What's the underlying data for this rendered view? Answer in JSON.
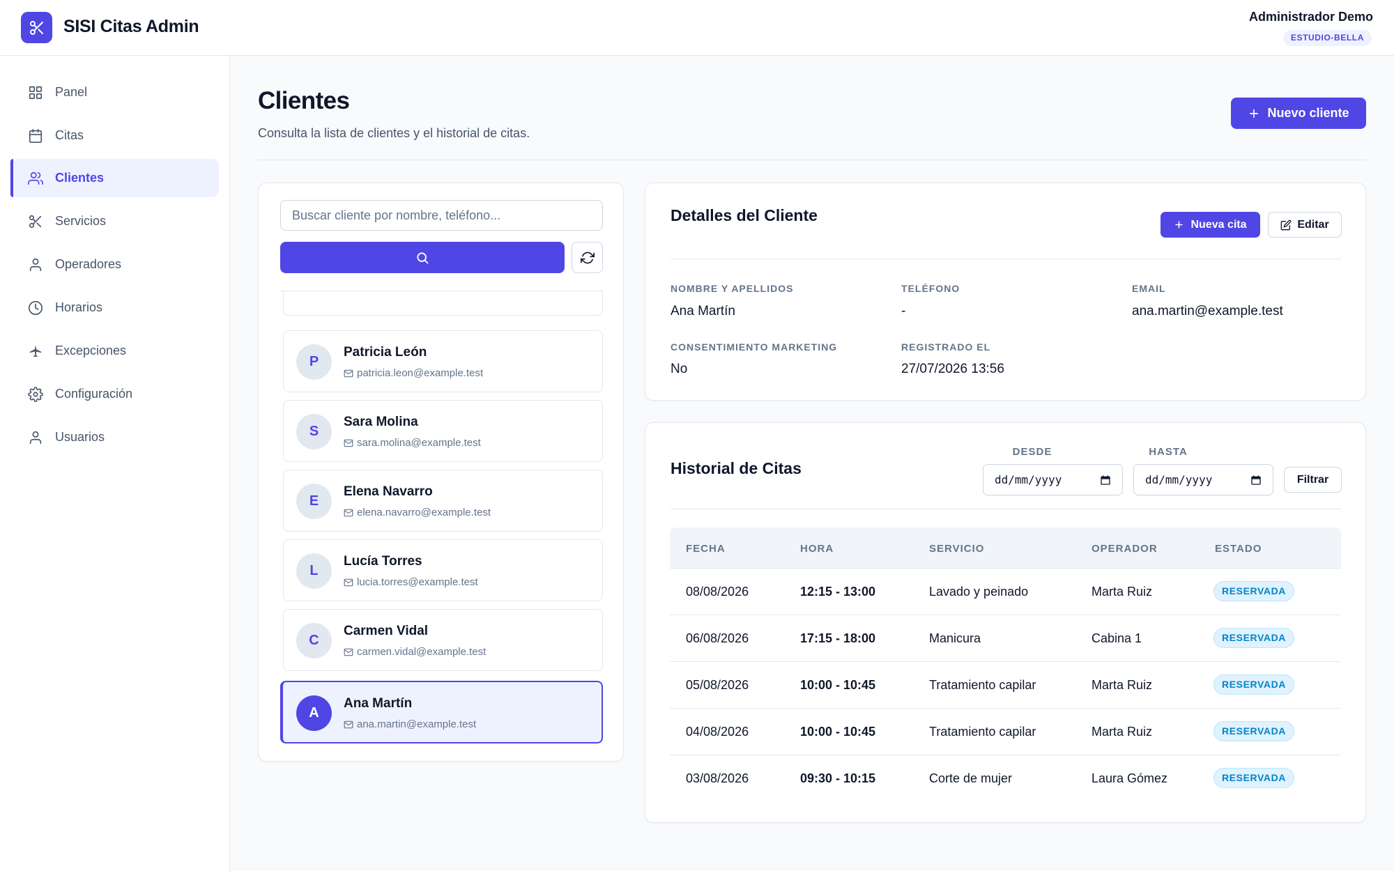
{
  "app": {
    "title": "SISI Citas Admin",
    "logo_icon": "scissors-icon",
    "accent_color": "#4f46e5"
  },
  "user": {
    "name": "Administrador Demo",
    "tenant": "ESTUDIO-BELLA"
  },
  "sidebar": {
    "items": [
      {
        "label": "Panel",
        "icon": "grid-icon"
      },
      {
        "label": "Citas",
        "icon": "calendar-icon"
      },
      {
        "label": "Clientes",
        "icon": "users-icon",
        "active": true
      },
      {
        "label": "Servicios",
        "icon": "scissors-icon"
      },
      {
        "label": "Operadores",
        "icon": "user-icon"
      },
      {
        "label": "Horarios",
        "icon": "clock-icon"
      },
      {
        "label": "Excepciones",
        "icon": "plane-icon"
      },
      {
        "label": "Configuración",
        "icon": "gear-icon"
      },
      {
        "label": "Usuarios",
        "icon": "user-icon"
      }
    ]
  },
  "page": {
    "title": "Clientes",
    "subtitle": "Consulta la lista de clientes y el historial de citas.",
    "new_client_label": "Nuevo cliente"
  },
  "search": {
    "placeholder": "Buscar cliente por nombre, teléfono...",
    "value": ""
  },
  "clients": [
    {
      "initial": "P",
      "name": "Patricia León",
      "email": "patricia.leon@example.test"
    },
    {
      "initial": "S",
      "name": "Sara Molina",
      "email": "sara.molina@example.test"
    },
    {
      "initial": "E",
      "name": "Elena Navarro",
      "email": "elena.navarro@example.test"
    },
    {
      "initial": "L",
      "name": "Lucía Torres",
      "email": "lucia.torres@example.test"
    },
    {
      "initial": "C",
      "name": "Carmen Vidal",
      "email": "carmen.vidal@example.test"
    },
    {
      "initial": "A",
      "name": "Ana Martín",
      "email": "ana.martin@example.test",
      "selected": true
    }
  ],
  "details": {
    "title": "Detalles del Cliente",
    "new_appointment_label": "Nueva cita",
    "edit_label": "Editar",
    "fields": {
      "name_label": "NOMBRE Y APELLIDOS",
      "name_value": "Ana Martín",
      "phone_label": "TELÉFONO",
      "phone_value": "-",
      "email_label": "EMAIL",
      "email_value": "ana.martin@example.test",
      "marketing_label": "CONSENTIMIENTO MARKETING",
      "marketing_value": "No",
      "registered_label": "REGISTRADO EL",
      "registered_value": "27/07/2026 13:56"
    }
  },
  "history": {
    "title": "Historial de Citas",
    "from_label": "DESDE",
    "to_label": "HASTA",
    "date_placeholder": "dd/mm/yyyy",
    "filter_label": "Filtrar",
    "columns": [
      "FECHA",
      "HORA",
      "SERVICIO",
      "OPERADOR",
      "ESTADO"
    ],
    "rows": [
      {
        "date": "08/08/2026",
        "time": "12:15 - 13:00",
        "service": "Lavado y peinado",
        "operator": "Marta Ruiz",
        "status": "RESERVADA"
      },
      {
        "date": "06/08/2026",
        "time": "17:15 - 18:00",
        "service": "Manicura",
        "operator": "Cabina 1",
        "status": "RESERVADA"
      },
      {
        "date": "05/08/2026",
        "time": "10:00 - 10:45",
        "service": "Tratamiento capilar",
        "operator": "Marta Ruiz",
        "status": "RESERVADA"
      },
      {
        "date": "04/08/2026",
        "time": "10:00 - 10:45",
        "service": "Tratamiento capilar",
        "operator": "Marta Ruiz",
        "status": "RESERVADA"
      },
      {
        "date": "03/08/2026",
        "time": "09:30 - 10:15",
        "service": "Corte de mujer",
        "operator": "Laura Gómez",
        "status": "RESERVADA"
      }
    ]
  }
}
